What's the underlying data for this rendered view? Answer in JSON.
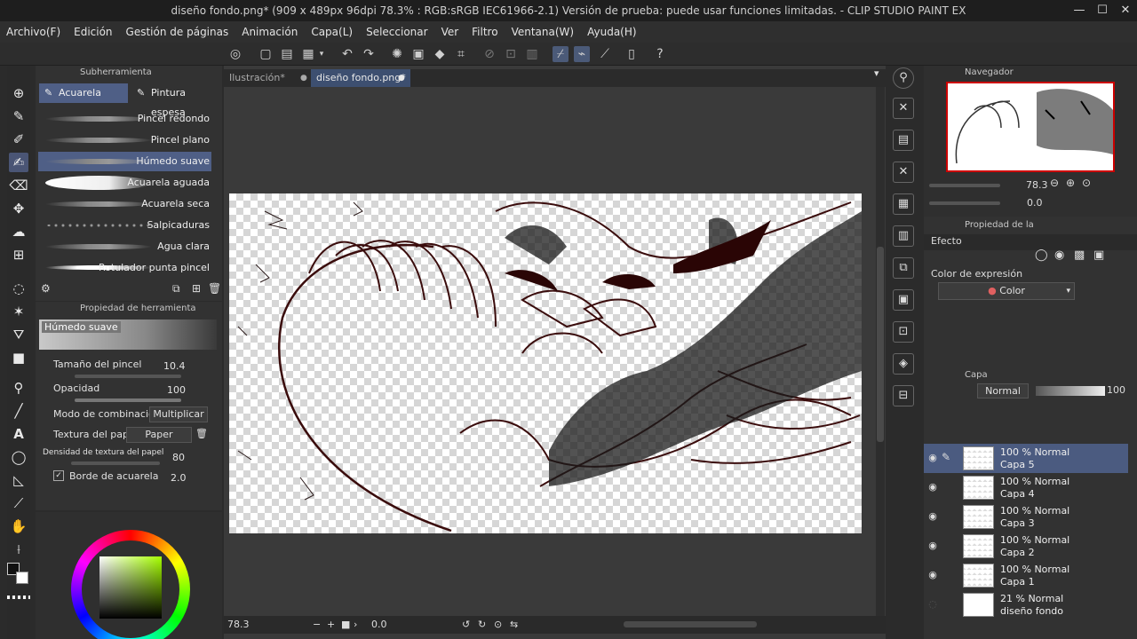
{
  "title_bar": {
    "text": "diseño fondo.png* (909 x 489px 96dpi 78.3% : RGB:sRGB IEC61966-2.1)  Versión de prueba: puede usar funciones limitadas. - CLIP STUDIO PAINT EX",
    "minimize": "—",
    "maximize": "☐",
    "close": "✕"
  },
  "menu": [
    "Archivo(F)",
    "Edición",
    "Gestión de páginas",
    "Animación",
    "Capa(L)",
    "Seleccionar",
    "Ver",
    "Filtro",
    "Ventana(W)",
    "Ayuda(H)"
  ],
  "subtool_panel": {
    "title": "Subherramienta",
    "tabs": [
      "Acuarela",
      "Pintura espesa"
    ],
    "brushes": [
      {
        "label": "Pincel redondo",
        "selected": false
      },
      {
        "label": "Pincel plano",
        "selected": false
      },
      {
        "label": "Húmedo suave",
        "selected": true
      },
      {
        "label": "Acuarela aguada",
        "selected": false
      },
      {
        "label": "Acuarela seca",
        "selected": false
      },
      {
        "label": "Salpicaduras",
        "selected": false
      },
      {
        "label": "Agua clara",
        "selected": false
      },
      {
        "label": "Rotulador punta pincel",
        "selected": false
      }
    ]
  },
  "tool_property": {
    "title": "Propiedad de herramienta",
    "preset_name": "Húmedo suave",
    "brush_size_label": "Tamaño del pincel",
    "brush_size_value": "10.4",
    "opacity_label": "Opacidad",
    "opacity_value": "100",
    "blend_label": "Modo de combinación",
    "blend_value": "Multiplicar",
    "paper_label": "Textura del papel",
    "paper_value": "Paper",
    "density_label": "Densidad de textura del papel",
    "density_value": "80",
    "edge_label": "Borde de acuarela",
    "edge_value": "2.0"
  },
  "doc_tabs": [
    {
      "label": "Ilustración*",
      "active": false
    },
    {
      "label": "diseño fondo.png*",
      "active": true
    }
  ],
  "status": {
    "zoom": "78.3",
    "angle": "0.0"
  },
  "navigator": {
    "title": "Navegador",
    "zoom": "78.3",
    "rotation": "0.0"
  },
  "effect_panel": {
    "title": "Propiedad de la",
    "effect_label": "Efecto",
    "color_expr_label": "Color de expresión",
    "color_expr_value": "Color"
  },
  "layer_panel": {
    "title": "Capa",
    "blend_mode": "Normal",
    "opacity": "100",
    "layers": [
      {
        "opacity_mode": "100 % Normal",
        "name": "Capa 5",
        "selected": true
      },
      {
        "opacity_mode": "100 % Normal",
        "name": "Capa 4",
        "selected": false
      },
      {
        "opacity_mode": "100 % Normal",
        "name": "Capa 3",
        "selected": false
      },
      {
        "opacity_mode": "100 % Normal",
        "name": "Capa 2",
        "selected": false
      },
      {
        "opacity_mode": "100 % Normal",
        "name": "Capa 1",
        "selected": false
      },
      {
        "opacity_mode": "21 % Normal",
        "name": "diseño fondo",
        "selected": false
      }
    ]
  },
  "colors": {
    "accent": "#4f5f86",
    "main_color": "#111111",
    "sub_color": "#ffffff"
  }
}
